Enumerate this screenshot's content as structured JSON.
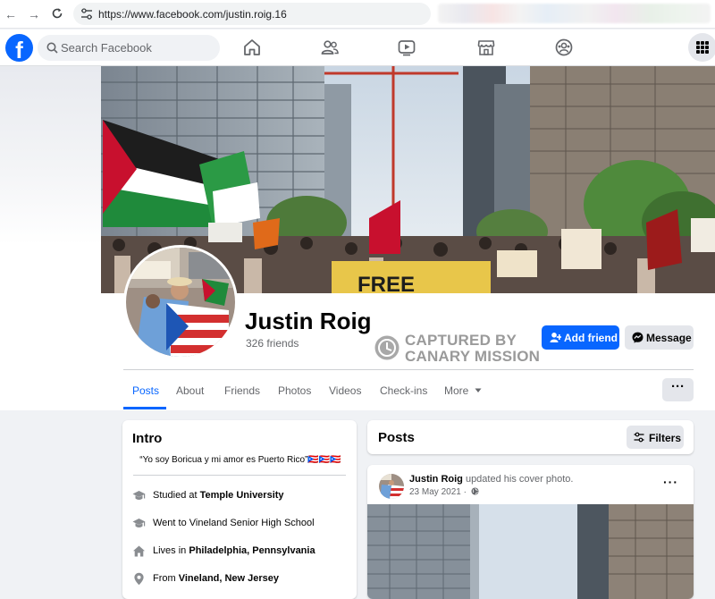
{
  "browser": {
    "url": "https://www.facebook.com/justin.roig.16"
  },
  "topbar": {
    "logo": "f",
    "search_placeholder": "Search Facebook",
    "nav_icons": [
      "home-icon",
      "friends-icon",
      "watch-icon",
      "marketplace-icon",
      "groups-icon"
    ],
    "menu_icon": "grid-menu-icon"
  },
  "profile": {
    "name": "Justin Roig",
    "friends": "326 friends",
    "add_friend_label": "Add friend",
    "message_label": "Message"
  },
  "watermark": {
    "line1": "CAPTURED BY",
    "line2": "CANARY MISSION"
  },
  "cover": {
    "sign_text": "FREE"
  },
  "tabs": [
    {
      "label": "Posts",
      "active": true
    },
    {
      "label": "About"
    },
    {
      "label": "Friends"
    },
    {
      "label": "Photos"
    },
    {
      "label": "Videos"
    },
    {
      "label": "Check-ins"
    },
    {
      "label": "More"
    }
  ],
  "tab_more_button": "···",
  "intro": {
    "title": "Intro",
    "bio": "“Yo soy Boricua y mi amor es Puerto Rico”🇵🇷🇵🇷🇵🇷",
    "items": [
      {
        "icon": "graduation-cap-icon",
        "prefix": "Studied at ",
        "bold": "Temple University"
      },
      {
        "icon": "graduation-cap-icon",
        "prefix": "Went to Vineland Senior High School",
        "bold": ""
      },
      {
        "icon": "home-icon",
        "prefix": "Lives in ",
        "bold": "Philadelphia, Pennsylvania"
      },
      {
        "icon": "location-pin-icon",
        "prefix": "From ",
        "bold": "Vineland, New Jersey"
      }
    ]
  },
  "posts": {
    "title": "Posts",
    "filters_label": "Filters",
    "post": {
      "author": "Justin Roig",
      "action": " updated his cover photo.",
      "date": "23 May 2021 ·",
      "menu": "···"
    }
  },
  "colors": {
    "brand_blue": "#0866ff",
    "bg": "#f0f2f5",
    "secondary_text": "#65676b",
    "button_grey": "#e4e6eb"
  }
}
